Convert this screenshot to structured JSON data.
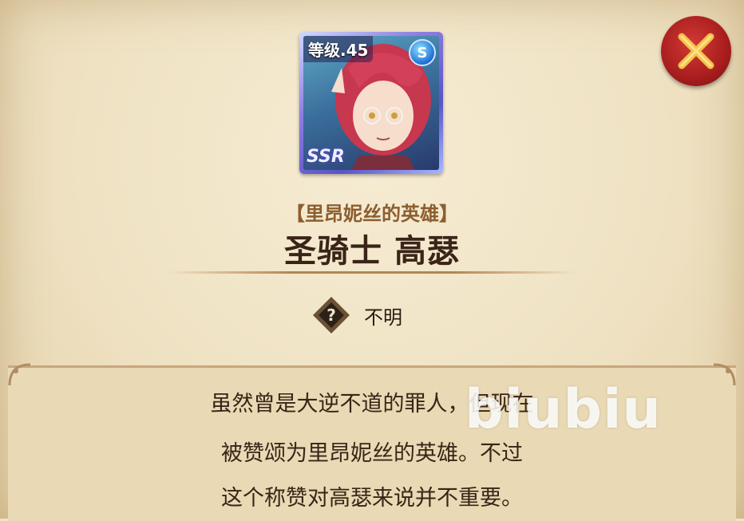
{
  "card": {
    "level": "等级.45",
    "rarity": "SSR",
    "attribute_icon": "speed-attribute-icon"
  },
  "close_icon": "close-x-icon",
  "hero": {
    "subtitle": "【里昂妮丝的英雄】",
    "name": "圣骑士 高瑟"
  },
  "attribute": {
    "icon": "unknown-question-icon",
    "label": "不明"
  },
  "description": {
    "lines": [
      "虽然曾是大逆不道的罪人，但现在",
      "被赞颂为里昂妮丝的英雄。不过",
      "这个称赞对高瑟来说并不重要。"
    ]
  },
  "watermark": "biubiu",
  "colors": {
    "parchment": "#efe3c6",
    "close_red": "#a81d1e",
    "title_dark": "#3a2417",
    "subtitle_brown": "#8b5e2f"
  }
}
